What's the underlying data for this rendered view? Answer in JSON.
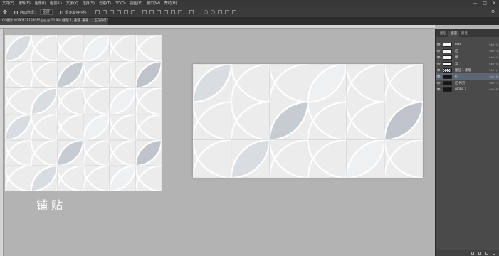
{
  "menubar": {
    "items": [
      "文件(F)",
      "编辑(E)",
      "图像(I)",
      "图层(L)",
      "文字(Y)",
      "选择(S)",
      "滤镜(T)",
      "3D(D)",
      "视图(V)",
      "窗口(W)",
      "帮助(H)"
    ],
    "window_controls": [
      "—",
      "□",
      "✕"
    ]
  },
  "options": {
    "auto_select_label": "自动选择：",
    "auto_select_value": "图层",
    "show_transform_label": "显示变换控件"
  },
  "document": {
    "tab_title": "QQ图片20190428184045.jpg @ 12.9% (图层 1, 通道, 通道 ...) 正在存储 10%"
  },
  "caption": "铺贴",
  "panel": {
    "tabs": [
      "图层",
      "通道",
      "路径"
    ],
    "active_tab": "通道",
    "channels": [
      {
        "name": "RGB",
        "shortcut": "Ctrl+2",
        "thumb": "light",
        "selected": false
      },
      {
        "name": "红",
        "shortcut": "Ctrl+3",
        "thumb": "light",
        "selected": false
      },
      {
        "name": "绿",
        "shortcut": "Ctrl+4",
        "thumb": "light",
        "selected": false
      },
      {
        "name": "蓝",
        "shortcut": "Ctrl+5",
        "thumb": "light",
        "selected": false
      },
      {
        "name": "图层 1 蒙版",
        "shortcut": "Ctrl+\\",
        "thumb": "pattern",
        "selected": false
      },
      {
        "name": "红",
        "shortcut": "Ctrl+6",
        "thumb": "dark",
        "selected": true
      },
      {
        "name": "红 拷贝",
        "shortcut": "Ctrl+7",
        "thumb": "dark",
        "selected": false
      },
      {
        "name": "Alpha 1",
        "shortcut": "Ctrl+8",
        "thumb": "dark",
        "selected": false
      }
    ]
  },
  "icons": {
    "eye": "eye-icon",
    "search": "search-icon"
  }
}
